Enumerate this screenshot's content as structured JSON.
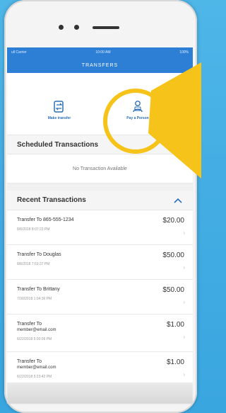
{
  "app": {
    "header_title": "TRANSFERS",
    "status_left": "ull Carrier",
    "status_center": "10:00 AM",
    "status_right": "100%"
  },
  "actions": {
    "make_transfer": "Make transfer",
    "pay_a_person": "Pay a Person"
  },
  "scheduled": {
    "title": "Scheduled Transactions",
    "empty": "No Transaction Available"
  },
  "recent": {
    "title": "Recent Transactions",
    "items": [
      {
        "title": "Transfer To 865-555-1234",
        "date": "8/8/2018 8:07:23 PM",
        "amount": "$20.00"
      },
      {
        "title": "Transfer To Douglas",
        "date": "8/8/2018 7:53:37 PM",
        "amount": "$50.00"
      },
      {
        "title": "Transfer To Brittany",
        "date": "7/30/2018 1:04:36 PM",
        "amount": "$50.00"
      },
      {
        "title": "Transfer To",
        "subtitle": "member@email.com",
        "date": "6/22/2018 5:00:09 PM",
        "amount": "$1.00"
      },
      {
        "title": "Transfer To",
        "subtitle": "member@email.com",
        "date": "6/22/2018 5:23:42 PM",
        "amount": "$1.00"
      }
    ]
  },
  "colors": {
    "background": "#44aee4",
    "header": "#2d7fd6",
    "highlight": "#f6c31a",
    "link": "#2c6fb8"
  }
}
